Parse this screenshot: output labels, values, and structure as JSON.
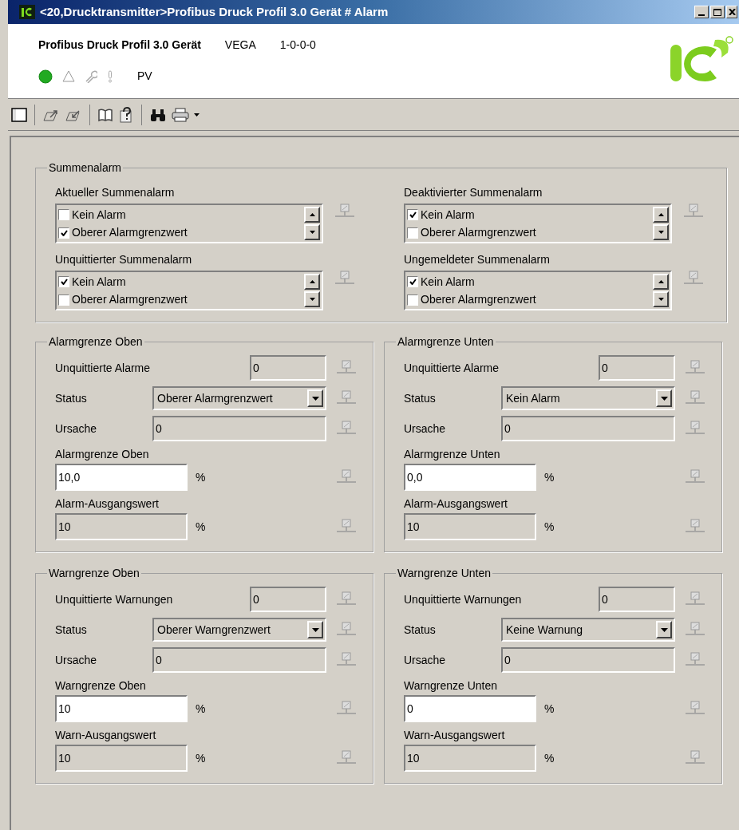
{
  "window": {
    "title": "<20,Drucktransmitter>Profibus Druck Profil 3.0 Gerät # Alarm"
  },
  "header": {
    "device": "Profibus Druck Profil 3.0 Gerät",
    "vendor": "VEGA",
    "version": "1-0-0-0",
    "status_text": "PV"
  },
  "summenalarm": {
    "title": "Summenalarm",
    "lists": [
      {
        "label": "Aktueller Summenalarm",
        "items": [
          {
            "label": "Kein Alarm",
            "checked": false
          },
          {
            "label": "Oberer Alarmgrenzwert",
            "checked": true
          }
        ]
      },
      {
        "label": "Deaktivierter Summenalarm",
        "items": [
          {
            "label": "Kein Alarm",
            "checked": true
          },
          {
            "label": "Oberer Alarmgrenzwert",
            "checked": false
          }
        ]
      },
      {
        "label": "Unquittierter Summenalarm",
        "items": [
          {
            "label": "Kein Alarm",
            "checked": true
          },
          {
            "label": "Oberer Alarmgrenzwert",
            "checked": false
          }
        ]
      },
      {
        "label": "Ungemeldeter Summenalarm",
        "items": [
          {
            "label": "Kein Alarm",
            "checked": true
          },
          {
            "label": "Oberer Alarmgrenzwert",
            "checked": false
          }
        ]
      }
    ]
  },
  "groups": [
    {
      "title": "Alarmgrenze Oben",
      "rows": [
        {
          "kind": "count",
          "label": "Unquittierte Alarme",
          "value": "0"
        },
        {
          "kind": "select",
          "label": "Status",
          "value": "Oberer Alarmgrenzwert"
        },
        {
          "kind": "text",
          "label": "Ursache",
          "value": "0"
        },
        {
          "kind": "limit",
          "label": "Alarmgrenze Oben",
          "value": "10,0",
          "unit": "%",
          "editable": true
        },
        {
          "kind": "limit",
          "label": "Alarm-Ausgangswert",
          "value": "10",
          "unit": "%",
          "editable": false
        }
      ]
    },
    {
      "title": "Alarmgrenze Unten",
      "rows": [
        {
          "kind": "count",
          "label": "Unquittierte Alarme",
          "value": "0"
        },
        {
          "kind": "select",
          "label": "Status",
          "value": "Kein Alarm"
        },
        {
          "kind": "text",
          "label": "Ursache",
          "value": "0"
        },
        {
          "kind": "limit",
          "label": "Alarmgrenze Unten",
          "value": "0,0",
          "unit": "%",
          "editable": true
        },
        {
          "kind": "limit",
          "label": "Alarm-Ausgangswert",
          "value": "10",
          "unit": "%",
          "editable": false
        }
      ]
    },
    {
      "title": "Warngrenze Oben",
      "rows": [
        {
          "kind": "count",
          "label": "Unquittierte Warnungen",
          "value": "0"
        },
        {
          "kind": "select",
          "label": "Status",
          "value": "Oberer Warngrenzwert"
        },
        {
          "kind": "text",
          "label": "Ursache",
          "value": "0"
        },
        {
          "kind": "limit",
          "label": "Warngrenze Oben",
          "value": "10",
          "unit": "%",
          "editable": true
        },
        {
          "kind": "limit",
          "label": "Warn-Ausgangswert",
          "value": "10",
          "unit": "%",
          "editable": false
        }
      ]
    },
    {
      "title": "Warngrenze Unten",
      "rows": [
        {
          "kind": "count",
          "label": "Unquittierte Warnungen",
          "value": "0"
        },
        {
          "kind": "select",
          "label": "Status",
          "value": "Keine Warnung"
        },
        {
          "kind": "text",
          "label": "Ursache",
          "value": "0"
        },
        {
          "kind": "limit",
          "label": "Warngrenze Unten",
          "value": "0",
          "unit": "%",
          "editable": true
        },
        {
          "kind": "limit",
          "label": "Warn-Ausgangswert",
          "value": "10",
          "unit": "%",
          "editable": false
        }
      ]
    }
  ]
}
